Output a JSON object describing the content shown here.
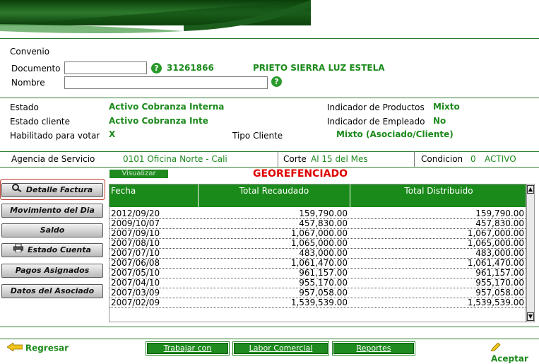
{
  "header": {
    "section_title": "Convenio"
  },
  "form": {
    "documento_label": "Documento",
    "documento_value": "",
    "nombre_label": "Nombre",
    "nombre_value": "",
    "document_number": "31261866",
    "client_name": "PRIETO SIERRA LUZ ESTELA"
  },
  "status": {
    "estado_label": "Estado",
    "estado_value": "Activo Cobranza Interna",
    "estado_cliente_label": "Estado cliente",
    "estado_cliente_value": "Activo Cobranza Inte",
    "habilitado_label": "Habilitado para votar",
    "habilitado_value": "X",
    "ind_productos_label": "Indicador de Productos",
    "ind_productos_value": "Mixto",
    "ind_empleado_label": "Indicador de Empleado",
    "ind_empleado_value": "No",
    "tipo_cliente_label": "Tipo Cliente",
    "tipo_cliente_value": "Mixto (Asociado/Cliente)"
  },
  "infobar": {
    "agencia_label": "Agencia de Servicio",
    "agencia_value": "0101 Oficina Norte - Cali",
    "corte_label": "Corte",
    "corte_value": "Al 15 del Mes",
    "condicion_label": "Condicion",
    "condicion_code": "0",
    "condicion_value": "ACTIVO"
  },
  "toolbar": {
    "visualizar_label": "Visualizar",
    "geo_label": "GEOREFENCIADO"
  },
  "sidebar": {
    "items": [
      {
        "label": "Detalle Factura",
        "icon": "magnifier-icon"
      },
      {
        "label": "Movimiento del Dia"
      },
      {
        "label": "Saldo"
      },
      {
        "label": "Estado Cuenta",
        "icon": "printer-icon"
      },
      {
        "label": "Pagos Asignados"
      },
      {
        "label": "Datos del Asociado"
      }
    ]
  },
  "table": {
    "columns": [
      "Fecha",
      "Total Recaudado",
      "Total Distribuido"
    ],
    "rows": [
      [
        "2012/09/20",
        "159,790.00",
        "159,790.00"
      ],
      [
        "2009/10/07",
        "457,830.00",
        "457,830.00"
      ],
      [
        "2007/09/10",
        "1,067,000.00",
        "1,067,000.00"
      ],
      [
        "2007/08/10",
        "1,065,000.00",
        "1,065,000.00"
      ],
      [
        "2007/07/10",
        "483,000.00",
        "483,000.00"
      ],
      [
        "2007/06/08",
        "1,061,470.00",
        "1,061,470.00"
      ],
      [
        "2007/05/10",
        "961,157.00",
        "961,157.00"
      ],
      [
        "2007/04/10",
        "955,170.00",
        "955,170.00"
      ],
      [
        "2007/03/09",
        "957,058.00",
        "957,058.00"
      ],
      [
        "2007/02/09",
        "1,539,539.00",
        "1,539,539.00"
      ]
    ]
  },
  "footer": {
    "regresar_label": "Regresar",
    "listados_label": "Trabajar con Listados",
    "labor_label": "Labor Comercial",
    "reportes_label": "Reportes Adicionales",
    "aceptar_label": "Aceptar"
  },
  "colors": {
    "accent_green": "#1a8a1a",
    "alert_red": "#e00000"
  }
}
